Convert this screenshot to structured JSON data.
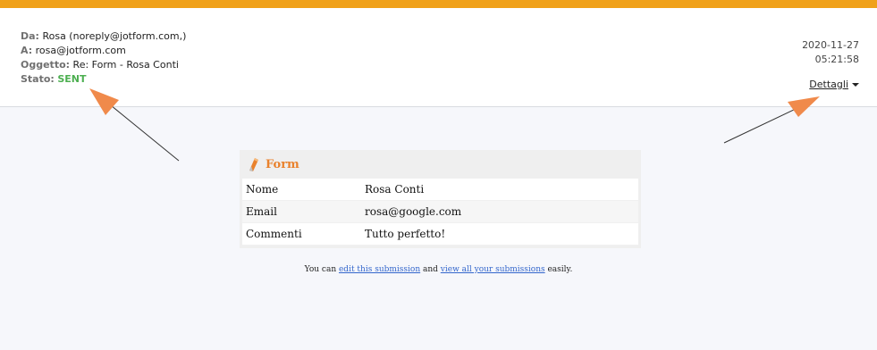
{
  "email": {
    "from_label": "Da:",
    "from_value": "Rosa (noreply@jotform.com,)",
    "to_label": "A:",
    "to_value": "rosa@jotform.com",
    "subject_label": "Oggetto:",
    "subject_value": "Re: Form - Rosa Conti",
    "status_label": "Stato:",
    "status_value": "SENT",
    "date": "2020-11-27",
    "time": "05:21:58",
    "details_label": "Dettagli"
  },
  "form": {
    "title": "Form",
    "rows": [
      {
        "field": "Nome",
        "value": "Rosa Conti"
      },
      {
        "field": "Email",
        "value": "rosa@google.com"
      },
      {
        "field": "Commenti",
        "value": "Tutto perfetto!"
      }
    ]
  },
  "footer": {
    "prefix": "You can ",
    "edit_link": "edit this submission",
    "middle": " and ",
    "view_link": "view all your submissions",
    "suffix": " easily."
  },
  "colors": {
    "accent_bar": "#f0a11a",
    "status_sent": "#4caf50",
    "form_title": "#e9822d",
    "annotation_arrow": "#f08a4b"
  }
}
